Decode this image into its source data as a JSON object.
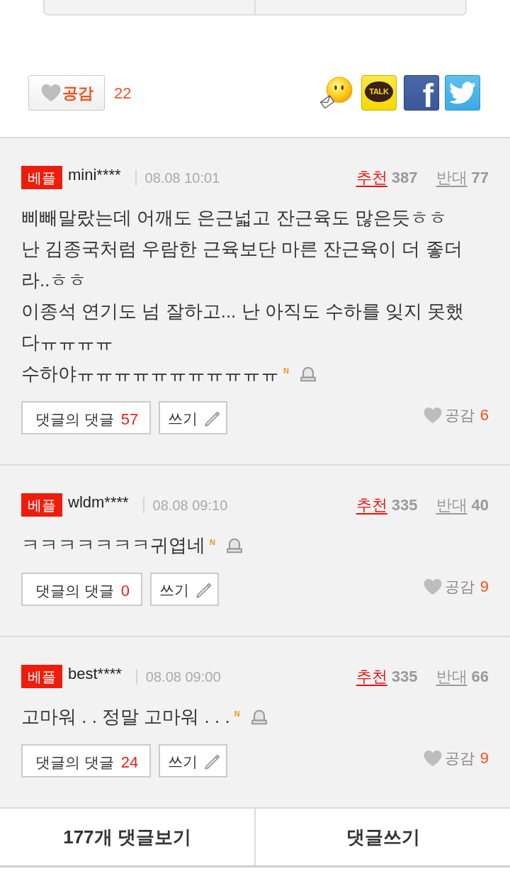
{
  "article_actions": {
    "like_button": {
      "label": "공감"
    },
    "like_count": "22",
    "share_buttons": [
      {
        "kind": "message"
      },
      {
        "kind": "kakaotalk",
        "label": "TALK"
      },
      {
        "kind": "facebook",
        "label": "f"
      },
      {
        "kind": "twitter"
      }
    ]
  },
  "comments": [
    {
      "badge": "베플",
      "username": "mini****",
      "time": "08.08 10:01",
      "recommend": {
        "label": "추천",
        "count": "387"
      },
      "oppose": {
        "label": "반대",
        "count": "77"
      },
      "text": "삐빼말랐는데 어깨도 은근넓고 잔근육도 많은듯ㅎㅎ\n난 김종국처럼 우람한 근육보단 마른 잔근육이 더 좋더\n라..ㅎㅎ\n이종석 연기도 넘 잘하고... 난 아직도 수하를 잊지 못했\n다ㅠㅠㅠㅠ\n수하야ㅠㅠㅠㅠㅠㅠㅠㅠㅠㅠㅠ",
      "new_mark": "N",
      "reply_button": {
        "label": "댓글의 댓글",
        "count": "57"
      },
      "write_button": {
        "label": "쓰기"
      },
      "like": {
        "label": "공감",
        "count": "6"
      }
    },
    {
      "badge": "베플",
      "username": "wldm****",
      "time": "08.08 09:10",
      "recommend": {
        "label": "추천",
        "count": "335"
      },
      "oppose": {
        "label": "반대",
        "count": "40"
      },
      "text": "ㅋㅋㅋㅋㅋㅋㅋ귀엽네",
      "new_mark": "N",
      "reply_button": {
        "label": "댓글의 댓글",
        "count": "0"
      },
      "write_button": {
        "label": "쓰기"
      },
      "like": {
        "label": "공감",
        "count": "9"
      }
    },
    {
      "badge": "베플",
      "username": "best****",
      "time": "08.08 09:00",
      "recommend": {
        "label": "추천",
        "count": "335"
      },
      "oppose": {
        "label": "반대",
        "count": "66"
      },
      "text": "고마워 . . 정말 고마워 . . .",
      "new_mark": "N",
      "reply_button": {
        "label": "댓글의 댓글",
        "count": "24"
      },
      "write_button": {
        "label": "쓰기"
      },
      "like": {
        "label": "공감",
        "count": "9"
      }
    }
  ],
  "bottom_bar": {
    "buttons": [
      {
        "label": "177개 댓글보기"
      },
      {
        "label": "댓글쓰기"
      }
    ]
  }
}
